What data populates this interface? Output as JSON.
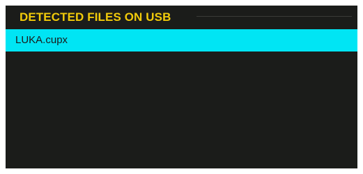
{
  "panel": {
    "title": "DETECTED FILES ON USB",
    "files": [
      {
        "name": "LUKA.cupx",
        "selected": true
      }
    ]
  },
  "colors": {
    "background": "#1b1c1a",
    "title": "#f2cb0a",
    "selection": "#00e5f4",
    "rule": "#3a3c38"
  }
}
